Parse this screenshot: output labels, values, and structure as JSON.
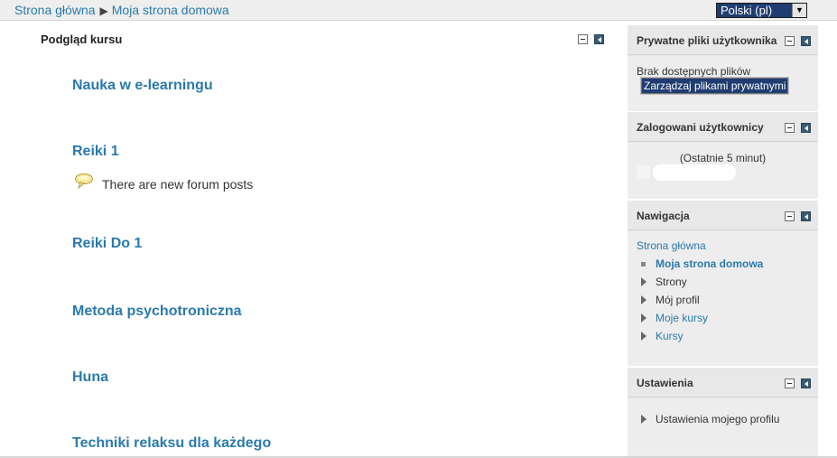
{
  "breadcrumb": {
    "home": "Strona główna",
    "separator": "▶",
    "current": "Moja strona domowa"
  },
  "language_select": {
    "value": "Polski (pl)",
    "arrow": "▼"
  },
  "main": {
    "title": "Podgląd kursu",
    "courses": [
      "Nauka w e-learningu",
      "Reiki 1",
      "Reiki Do 1",
      "Metoda psychotroniczna",
      "Huna",
      "Techniki relaksu dla każdego"
    ],
    "forum_note": "There are new forum posts",
    "forum_icon": "speech-bubble-icon"
  },
  "blocks": {
    "private_files": {
      "title": "Prywatne pliki użytkownika",
      "empty_text": "Brak dostępnych plików",
      "manage_button": "Zarządzaj plikami prywatnymi"
    },
    "online_users": {
      "title": "Zalogowani użytkownicy",
      "period": "(Ostatnie 5 minut)"
    },
    "navigation": {
      "title": "Nawigacja",
      "home": "Strona główna",
      "items": [
        "Moja strona domowa",
        "Strony",
        "Mój profil",
        "Moje kursy",
        "Kursy"
      ]
    },
    "settings": {
      "title": "Ustawienia",
      "items": [
        "Ustawienia mojego profilu"
      ]
    }
  },
  "colors": {
    "link": "#2a7aab",
    "dark_button": "#203d72",
    "block_background": "#e8e8e8",
    "dock_icon": "#3a5a74"
  }
}
